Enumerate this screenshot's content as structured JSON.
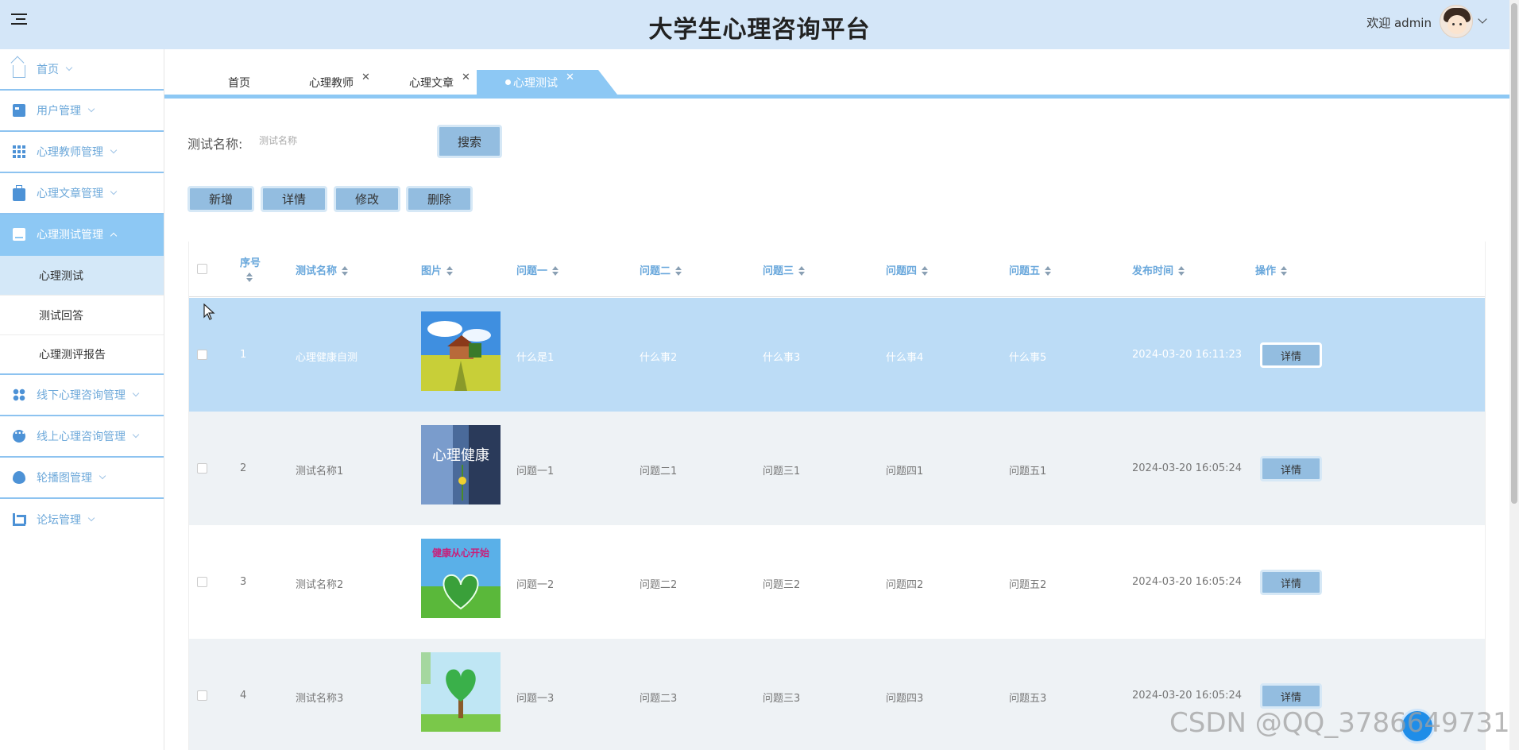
{
  "header": {
    "title": "大学生心理咨询平台",
    "welcome": "欢迎 admin",
    "menu_icon": "hamburger-icon",
    "bg_color": "#d4e6f8"
  },
  "sidebar": {
    "items": [
      {
        "label": "首页",
        "icon": "home-icon"
      },
      {
        "label": "用户管理",
        "icon": "id-card-icon"
      },
      {
        "label": "心理教师管理",
        "icon": "grid-icon"
      },
      {
        "label": "心理文章管理",
        "icon": "briefcase-icon"
      },
      {
        "label": "心理测试管理",
        "icon": "monitor-icon",
        "active": true
      },
      {
        "label": "线下心理咨询管理",
        "icon": "clover-icon"
      },
      {
        "label": "线上心理咨询管理",
        "icon": "chat-icon"
      },
      {
        "label": "轮播图管理",
        "icon": "drop-icon"
      },
      {
        "label": "论坛管理",
        "icon": "crop-icon"
      }
    ],
    "sub_items": [
      {
        "label": "心理测试",
        "active": true
      },
      {
        "label": "测试回答"
      },
      {
        "label": "心理测评报告"
      }
    ]
  },
  "tabs": [
    {
      "label": "首页",
      "closable": false
    },
    {
      "label": "心理教师",
      "closable": true
    },
    {
      "label": "心理文章",
      "closable": true
    },
    {
      "label": "心理测试",
      "closable": true,
      "active": true
    }
  ],
  "search": {
    "label": "测试名称:",
    "placeholder": "测试名称",
    "button": "搜索"
  },
  "actions": {
    "add": "新增",
    "detail": "详情",
    "edit": "修改",
    "delete": "删除"
  },
  "table": {
    "columns": [
      "序号",
      "测试名称",
      "图片",
      "问题一",
      "问题二",
      "问题三",
      "问题四",
      "问题五",
      "发布时间",
      "操作"
    ],
    "rows": [
      {
        "index": "1",
        "name": "心理健康自测",
        "image": "house-in-field",
        "q1": "什么是1",
        "q2": "什么事2",
        "q3": "什么事3",
        "q4": "什么事4",
        "q5": "什么事5",
        "time": "2024-03-20 16:11:23",
        "action": "详情",
        "selected": true
      },
      {
        "index": "2",
        "name": "测试名称1",
        "image": "xinli-jiankang-flower",
        "q1": "问题一1",
        "q2": "问题二1",
        "q3": "问题三1",
        "q4": "问题四1",
        "q5": "问题五1",
        "time": "2024-03-20 16:05:24",
        "action": "详情"
      },
      {
        "index": "3",
        "name": "测试名称2",
        "image": "green-heart-meadow",
        "q1": "问题一2",
        "q2": "问题二2",
        "q3": "问题三2",
        "q4": "问题四2",
        "q5": "问题五2",
        "time": "2024-03-20 16:05:24",
        "action": "详情"
      },
      {
        "index": "4",
        "name": "测试名称3",
        "image": "heart-tree",
        "q1": "问题一3",
        "q2": "问题二3",
        "q3": "问题三3",
        "q4": "问题四3",
        "q5": "问题五3",
        "time": "2024-03-20 16:05:24",
        "action": "详情"
      }
    ]
  },
  "thumb_text": {
    "row2": "心理健康",
    "row3": "健康从心开始"
  },
  "colors": {
    "accent": "#8dc8f4",
    "button": "#93bde0",
    "selected_row": "#bcdcf6",
    "header_text": "#6aa8dc"
  },
  "watermark": "CSDN @QQ_3786649731"
}
